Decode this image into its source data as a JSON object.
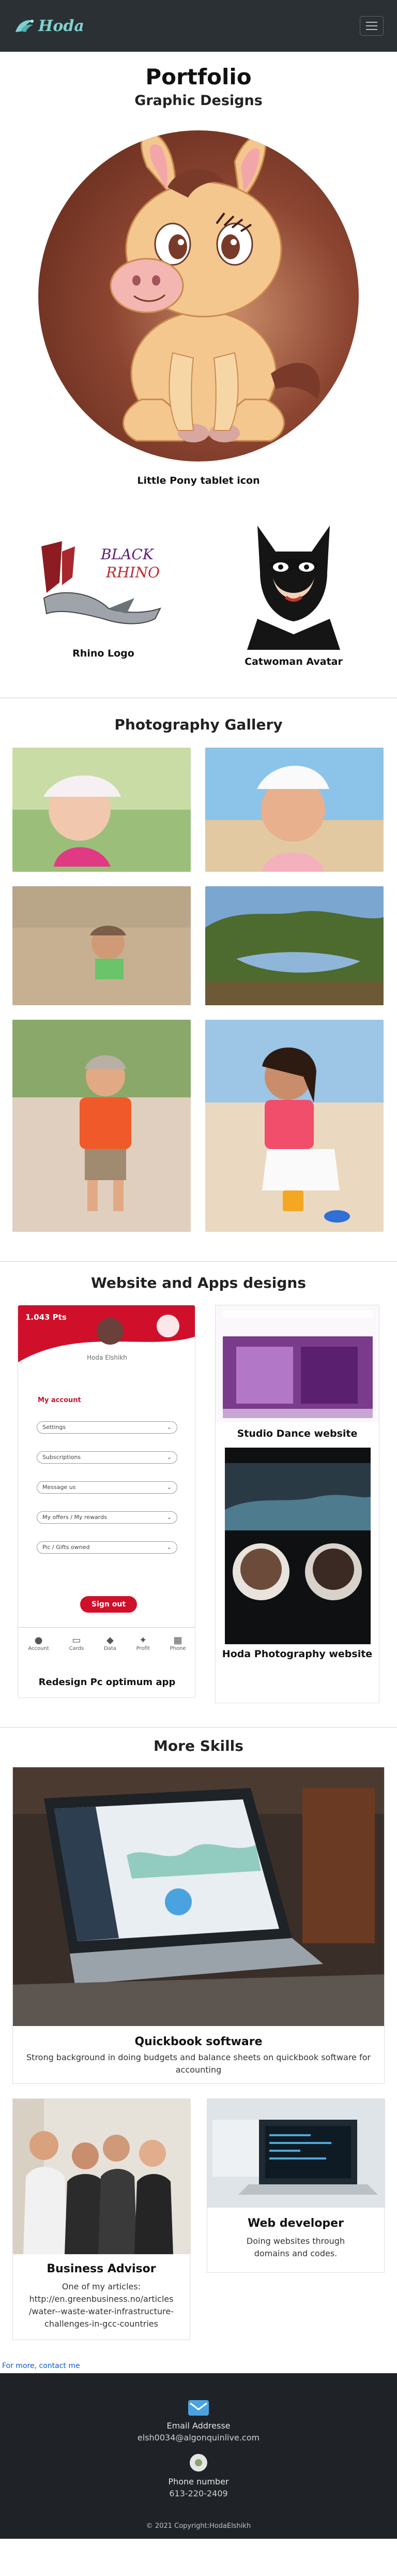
{
  "navbar": {
    "brand": "Hoda",
    "menu_icon": "hamburger-icon"
  },
  "portfolio": {
    "title": "Portfolio",
    "subtitle": "Graphic Designs"
  },
  "graphic_designs": [
    {
      "caption": "Little Pony tablet icon"
    },
    {
      "caption": "Rhino Logo",
      "logo_text_1": "BLACK",
      "logo_text_2": "RHINO"
    },
    {
      "caption": "Catwoman Avatar"
    }
  ],
  "gallery": {
    "title": "Photography Gallery"
  },
  "web_apps": {
    "title": "Website and Apps designs",
    "app": {
      "balance": "1.043 Pts",
      "user": "Hoda  Elshikh",
      "section": "My account",
      "fields": [
        "Settings",
        "Subscriptions",
        "Message us",
        "My offers / My rewards",
        "Pic / Gifts owned"
      ],
      "signout": "Sign out",
      "tabs": [
        "Account",
        "Cards",
        "Data",
        "Profit",
        "Phone"
      ],
      "caption": "Redesign Pc optimum app"
    },
    "dance": {
      "caption": "Studio Dance website"
    },
    "photo_site": {
      "caption": "Hoda Photography website"
    }
  },
  "skills": {
    "title": "More Skills",
    "items": [
      {
        "title": "Quickbook software",
        "text": "Strong background in doing budgets and balance sheets on quickbook software for accounting"
      },
      {
        "title": "Business Advisor",
        "text": "One of my articles:",
        "link": "http://en.greenbusiness.no/articles /water--waste-water-infrastructure- challenges-in-gcc-countries"
      },
      {
        "title": "Web developer",
        "text": "Doing websites through domains and codes."
      }
    ]
  },
  "footer": {
    "more_link": "For more, contact me",
    "email_label": "Email Addresse",
    "email": "elsh0034@algonquinlive.com",
    "phone_label": "Phone number",
    "phone": "613-220-2409",
    "copyright": "© 2021 Copyright:HodaElshikh"
  }
}
